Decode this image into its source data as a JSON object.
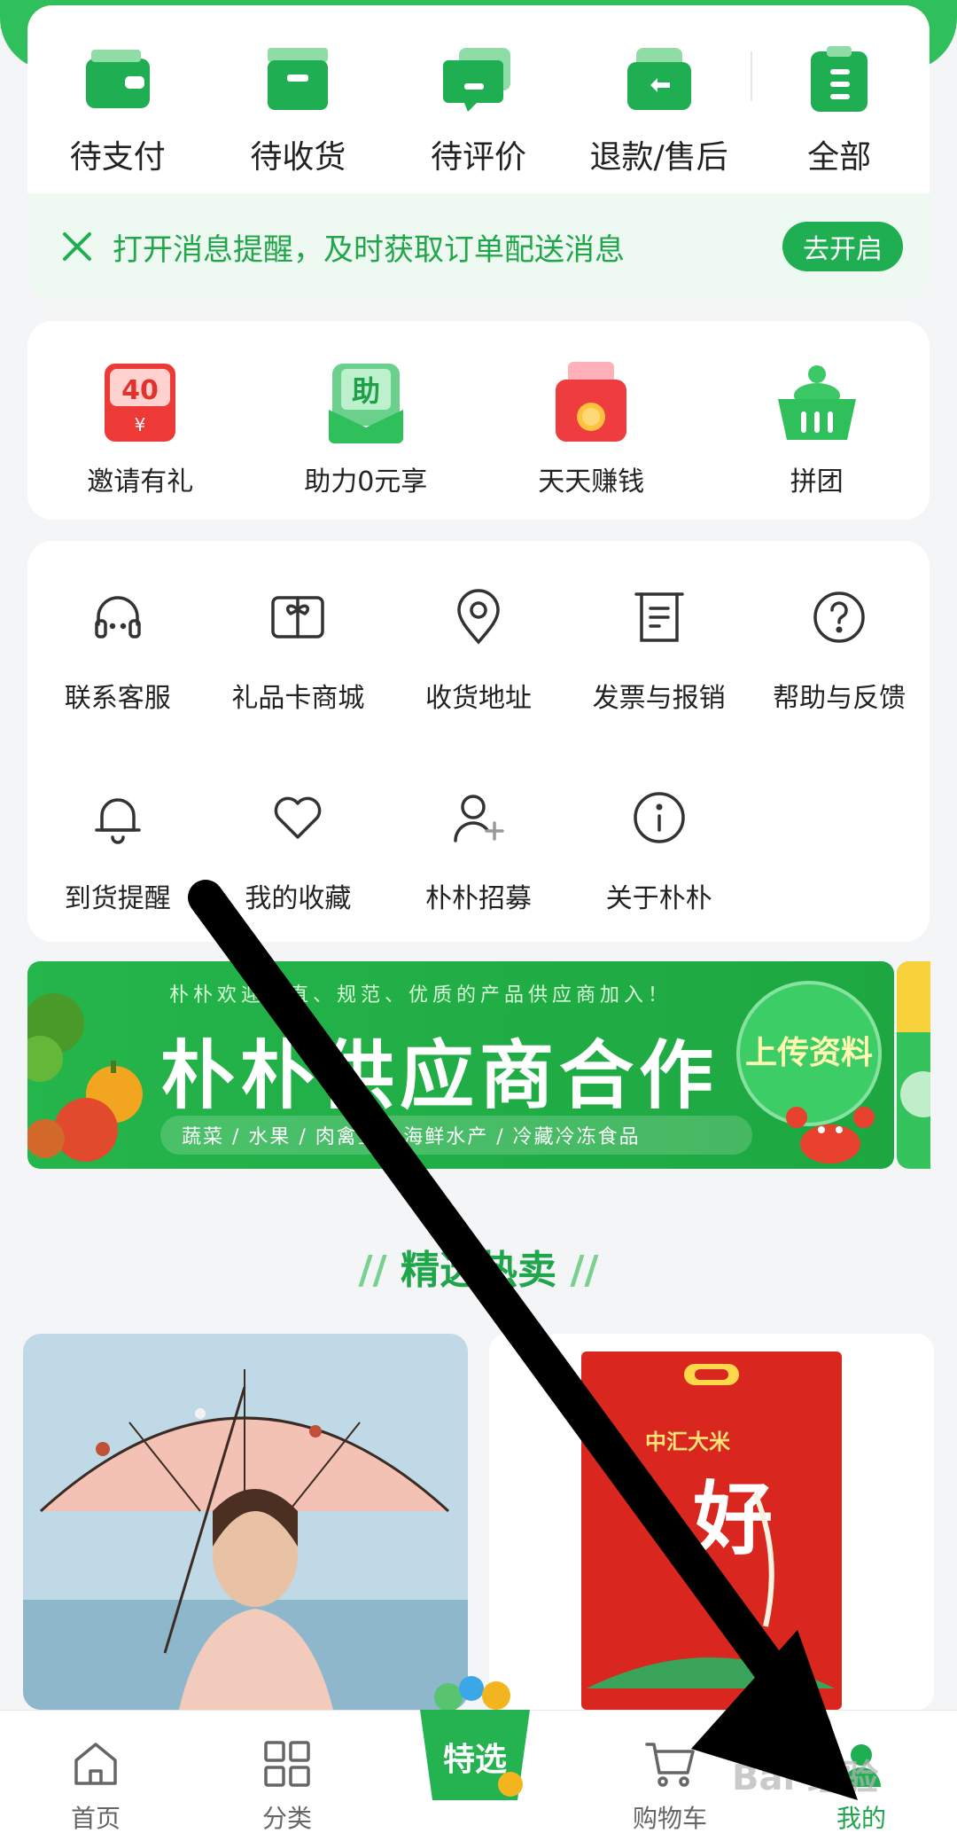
{
  "colors": {
    "primary_green": "#1fae52",
    "text": "#222222",
    "notice_bg": "#eefaf1"
  },
  "orders": {
    "items": [
      {
        "label": "待支付",
        "icon": "wallet-icon"
      },
      {
        "label": "待收货",
        "icon": "box-icon"
      },
      {
        "label": "待评价",
        "icon": "comment-icon"
      },
      {
        "label": "退款/售后",
        "icon": "refund-icon"
      },
      {
        "label": "全部",
        "icon": "clipboard-icon"
      }
    ]
  },
  "notice": {
    "text": "打开消息提醒，及时获取订单配送消息",
    "button": "去开启"
  },
  "promo": {
    "items": [
      {
        "label": "邀请有礼",
        "badge": "40",
        "icon": "red-envelope-icon"
      },
      {
        "label": "助力0元享",
        "badge": "助",
        "icon": "boost-envelope-icon"
      },
      {
        "label": "天天赚钱",
        "icon": "coin-envelope-icon"
      },
      {
        "label": "拼团",
        "icon": "group-basket-icon"
      }
    ]
  },
  "services": {
    "items": [
      {
        "label": "联系客服",
        "icon": "headset-icon"
      },
      {
        "label": "礼品卡商城",
        "icon": "gift-card-icon"
      },
      {
        "label": "收货地址",
        "icon": "location-pin-icon"
      },
      {
        "label": "发票与报销",
        "icon": "invoice-icon"
      },
      {
        "label": "帮助与反馈",
        "icon": "help-icon"
      },
      {
        "label": "到货提醒",
        "icon": "bell-icon"
      },
      {
        "label": "我的收藏",
        "icon": "heart-icon"
      },
      {
        "label": "朴朴招募",
        "icon": "add-user-icon"
      },
      {
        "label": "关于朴朴",
        "icon": "info-icon"
      }
    ]
  },
  "banner": {
    "subtitle": "朴朴欢迎正直、规范、优质的产品供应商加入！",
    "title": "朴朴供应商合作",
    "chips": "蔬菜 / 水果 / 肉禽蛋 / 海鲜水产 / 冷藏冷冻食品",
    "cta": "上传资料"
  },
  "section_title": "精选热卖",
  "products": [
    {
      "name": "umbrella-product"
    },
    {
      "name": "rice-product",
      "brand": "中汇大米",
      "text": "好"
    }
  ],
  "bottom_nav": {
    "items": [
      {
        "label": "首页",
        "icon": "home-icon"
      },
      {
        "label": "分类",
        "icon": "category-icon"
      },
      {
        "label": "特选",
        "icon": "featured-basket-icon"
      },
      {
        "label": "购物车",
        "icon": "cart-icon"
      },
      {
        "label": "我的",
        "icon": "profile-icon",
        "active": true
      }
    ]
  },
  "watermark": "Bai 经验"
}
